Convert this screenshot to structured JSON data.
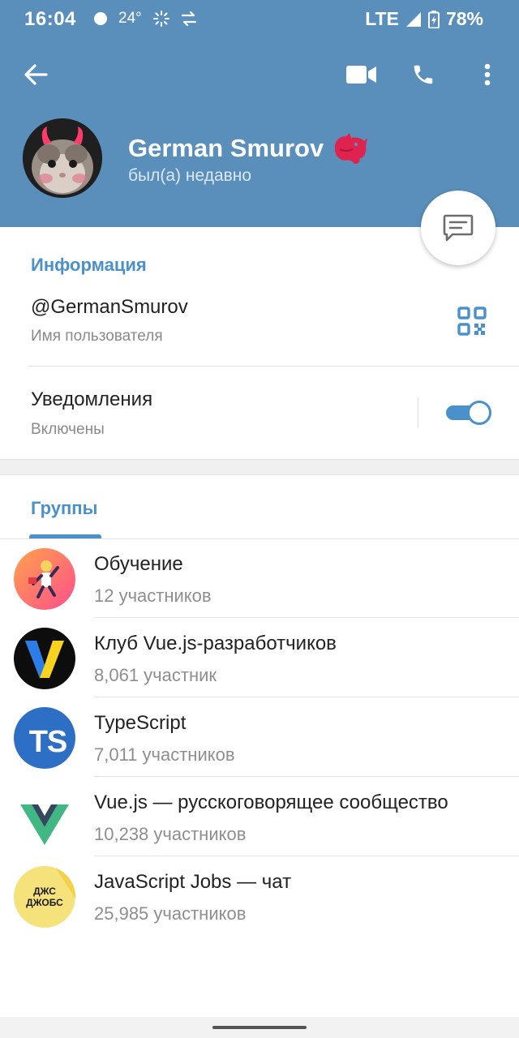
{
  "status_bar": {
    "time": "16:04",
    "temperature": "24°",
    "network": "LTE",
    "battery": "78%"
  },
  "toolbar": {
    "back_icon": "arrow-left-icon",
    "video_icon": "video-camera-icon",
    "call_icon": "phone-icon",
    "more_icon": "more-vertical-icon"
  },
  "profile": {
    "name": "German Smurov",
    "status": "был(а) недавно",
    "emoji_status_icon": "cat-emoji-icon"
  },
  "info": {
    "title": "Информация",
    "username": "@GermanSmurov",
    "username_caption": "Имя пользователя",
    "notifications_label": "Уведомления",
    "notifications_caption": "Включены",
    "notifications_enabled": true
  },
  "tabs": [
    {
      "label": "Группы",
      "active": true
    }
  ],
  "groups": [
    {
      "name": "Обучение",
      "count": "12 участников",
      "avatar": "education-avatar"
    },
    {
      "name": "Клуб Vue.js-разработчиков",
      "count": "8,061 участник",
      "avatar": "vue-club-avatar"
    },
    {
      "name": "TypeScript",
      "count": "7,011 участников",
      "avatar": "typescript-avatar",
      "avatar_text": "TS"
    },
    {
      "name": "Vue.js — русскоговорящее сообщество",
      "count": "10,238 участников",
      "avatar": "vue-logo-avatar"
    },
    {
      "name": "JavaScript Jobs — чат",
      "count": "25,985 участников",
      "avatar": "js-jobs-avatar",
      "avatar_text_1": "ДЖС",
      "avatar_text_2": "ДЖОБС"
    }
  ],
  "colors": {
    "header": "#5a8fbb",
    "accent": "#4a90c9",
    "toggle_on": "#4a90c9"
  }
}
